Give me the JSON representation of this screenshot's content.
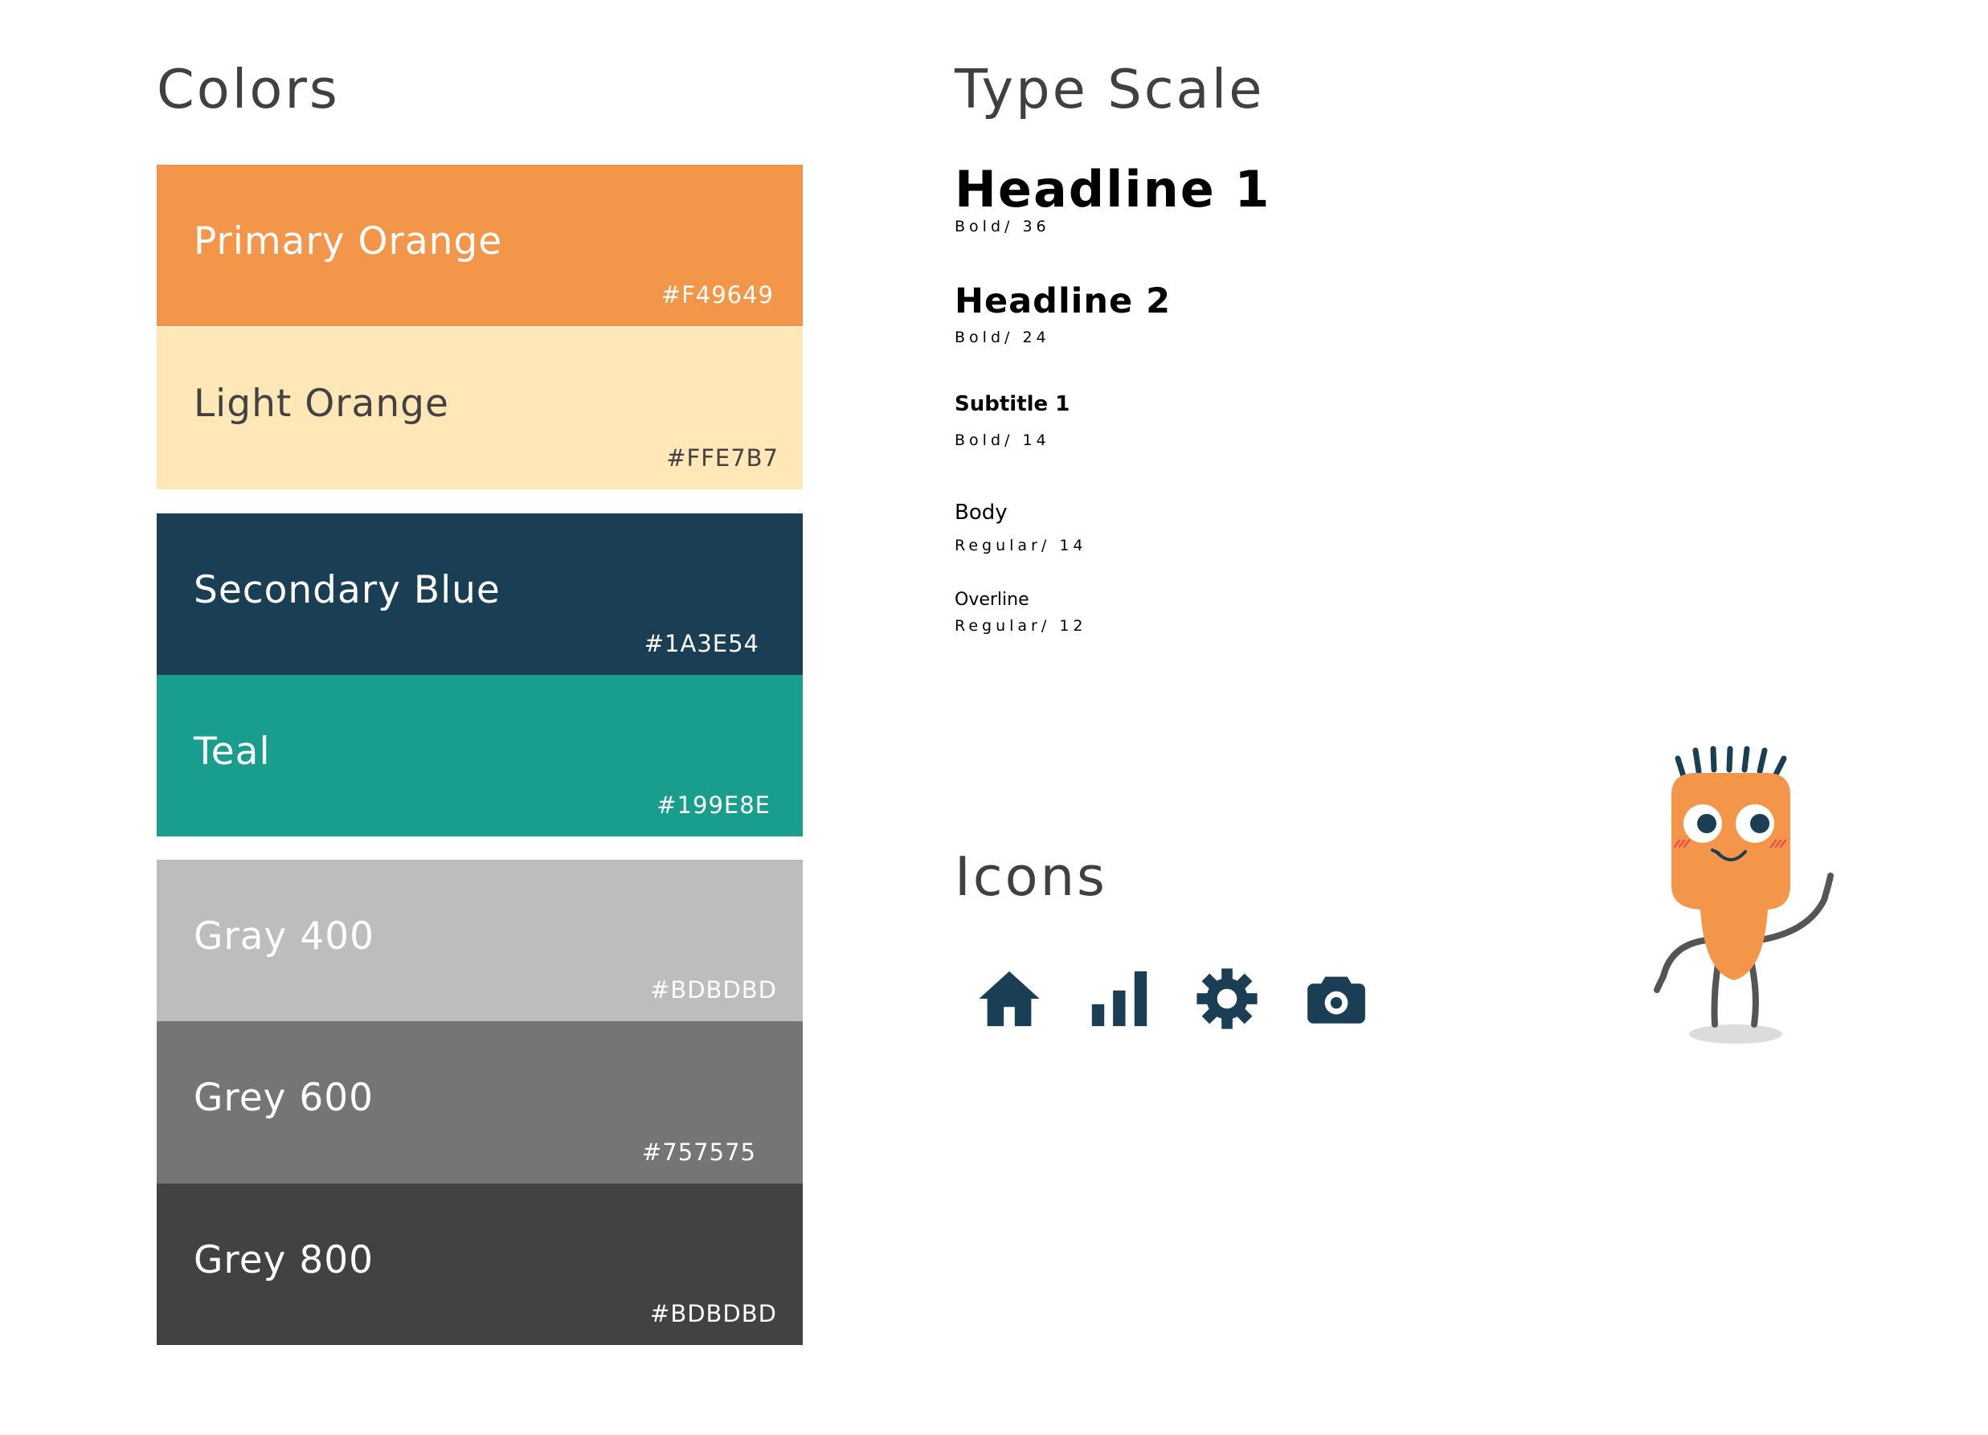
{
  "colors_section": {
    "title": "Colors",
    "swatches": [
      {
        "name": "Primary Orange",
        "hex": "#F49649",
        "bg": "#F49649",
        "fg": "#FFFFFF"
      },
      {
        "name": "Light Orange",
        "hex": "#FFE7B7",
        "bg": "#FFE7B7",
        "fg": "#424242"
      },
      {
        "name": "Secondary Blue",
        "hex": "#1A3E54",
        "bg": "#1A3E54",
        "fg": "#FFFFFF"
      },
      {
        "name": "Teal",
        "hex": "#199E8E",
        "bg": "#199E8E",
        "fg": "#FFFFFF"
      },
      {
        "name": "Gray 400",
        "hex": "#BDBDBD",
        "bg": "#BDBDBD",
        "fg": "#FFFFFF"
      },
      {
        "name": "Grey 600",
        "hex": "#757575",
        "bg": "#757575",
        "fg": "#FFFFFF"
      },
      {
        "name": "Grey 800",
        "hex": "#BDBDBD",
        "bg": "#424242",
        "fg": "#FFFFFF"
      }
    ]
  },
  "type_scale": {
    "title": "Type Scale",
    "items": [
      {
        "sample": "Headline 1",
        "spec": "Bold/ 36"
      },
      {
        "sample": "Headline 2",
        "spec": "Bold/ 24"
      },
      {
        "sample": "Subtitle 1",
        "spec": "Bold/ 14"
      },
      {
        "sample": "Body",
        "spec": "Regular/ 14"
      },
      {
        "sample": "Overline",
        "spec": "Regular/ 12"
      }
    ]
  },
  "icons_section": {
    "title": "Icons",
    "icon_color": "#1A3E54",
    "icons": [
      "home-icon",
      "bar-chart-icon",
      "settings-gear-icon",
      "camera-icon"
    ]
  },
  "mascot": {
    "name": "orange-mascot-character",
    "body_color": "#F49649",
    "limb_color": "#555555"
  }
}
